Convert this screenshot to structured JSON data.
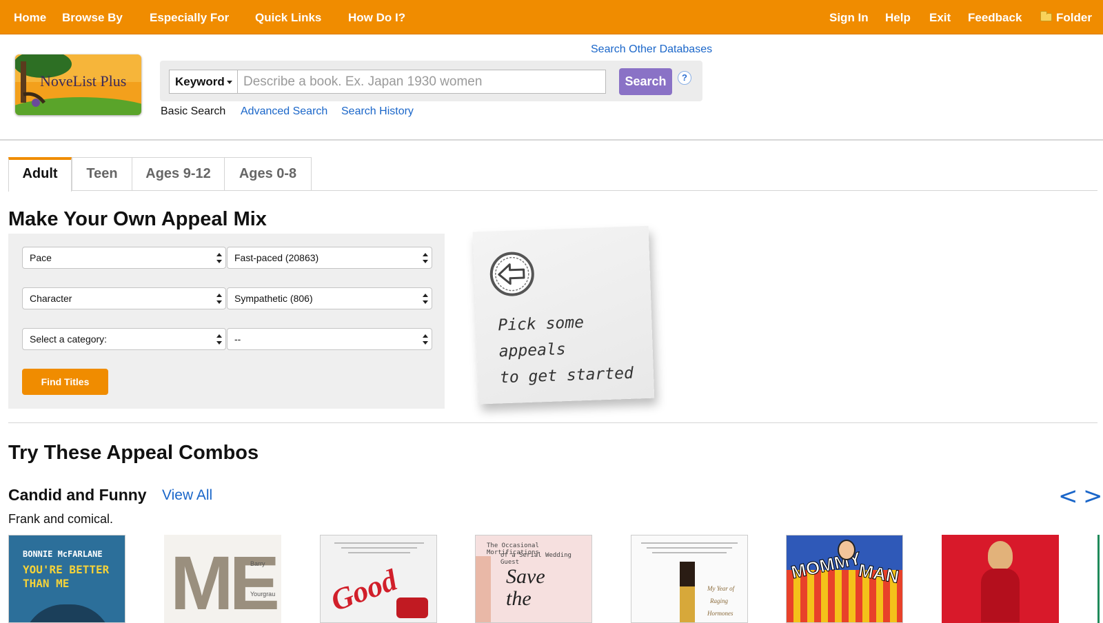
{
  "topnav": {
    "home": "Home",
    "browse_by": "Browse By",
    "especially_for": "Especially For",
    "quick_links": "Quick Links",
    "how_do_i": "How Do I?",
    "sign_in": "Sign In",
    "help": "Help",
    "exit": "Exit",
    "feedback": "Feedback",
    "folder": "Folder"
  },
  "header": {
    "logo_text": "NoveList Plus",
    "search_other": "Search Other Databases",
    "search_type": "Keyword",
    "search_placeholder": "Describe a book. Ex. Japan 1930 women",
    "search_button": "Search",
    "help_icon": "?",
    "basic_search": "Basic Search",
    "advanced_search": "Advanced Search",
    "search_history": "Search History"
  },
  "tabs": [
    {
      "label": "Adult",
      "active": true
    },
    {
      "label": "Teen",
      "active": false
    },
    {
      "label": "Ages 9-12",
      "active": false
    },
    {
      "label": "Ages 0-8",
      "active": false
    }
  ],
  "appeal_mix": {
    "title": "Make Your Own Appeal Mix",
    "rows": [
      {
        "category": "Pace",
        "value": "Fast-paced (20863)"
      },
      {
        "category": "Character",
        "value": "Sympathetic (806)"
      },
      {
        "category": "Select a category:",
        "value": "--"
      }
    ],
    "find_button": "Find Titles",
    "note_text_1": "Pick some appeals",
    "note_text_2": "to get started"
  },
  "combos": {
    "title": "Try These Appeal Combos",
    "combo_title": "Candid and Funny",
    "view_all": "View All",
    "description": "Frank and comical.",
    "prev": "<",
    "next": ">",
    "covers": [
      {
        "line1": "BONNIE McFARLANE",
        "line2": "YOU'RE BETTER",
        "line3": "THAN ME",
        "bg": "#2c6f9a"
      },
      {
        "line1": "ME",
        "line2": "Barry",
        "line3": "Yourgrau",
        "bg": "#f4f2ee"
      },
      {
        "line1": "Good",
        "line2": "",
        "line3": "",
        "bg": "#f2f2f2"
      },
      {
        "line1": "The Occasional Mortifications",
        "line2": "of a Serial Wedding Guest",
        "line3": "Save the",
        "bg": "#f6e0df"
      },
      {
        "line1": "My Year of",
        "line2": "Raging",
        "line3": "Hormones",
        "bg": "#fafafa"
      },
      {
        "line1": "MOMMY",
        "line2": "MAN",
        "line3": "",
        "bg": "#2f59b8"
      },
      {
        "line1": "",
        "line2": "",
        "line3": "",
        "bg": "#d8192a"
      }
    ]
  },
  "colors": {
    "nav_orange": "#f08c00",
    "link_blue": "#1a66c9",
    "search_purple": "#8a72c6"
  }
}
